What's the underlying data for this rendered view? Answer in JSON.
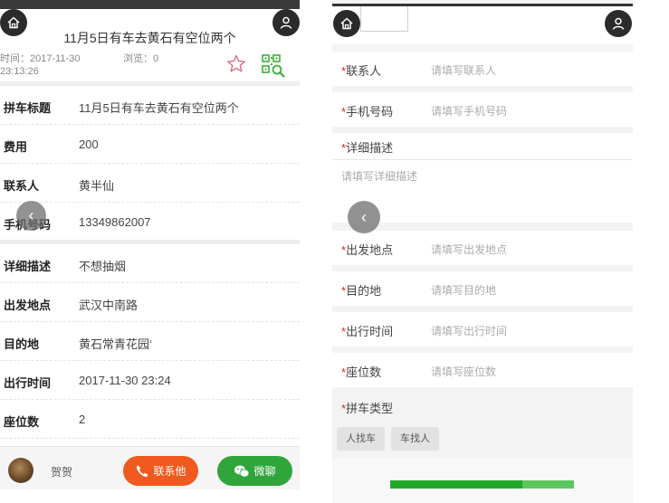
{
  "detail": {
    "title": "11月5日有车去黄石有空位两个",
    "time_label": "时间：2017-11-30 23:13:26",
    "views_label": "浏览：0",
    "rows": [
      {
        "label": "拼车标题",
        "value": "11月5日有车去黄石有空位两个"
      },
      {
        "label": "费用",
        "value": "200"
      },
      {
        "label": "联系人",
        "value": "黄半仙"
      },
      {
        "label": "手机号码",
        "value": "13349862007"
      },
      {
        "label": "详细描述",
        "value": "不想抽烟"
      },
      {
        "label": "出发地点",
        "value": "武汉中南路"
      },
      {
        "label": "目的地",
        "value": "黄石常青花园‘"
      },
      {
        "label": "出行时间",
        "value": "2017-11-30 23:24"
      },
      {
        "label": "座位数",
        "value": "2"
      }
    ],
    "footer": {
      "username": "贺贺",
      "call_label": "联系他",
      "wechat_label": "微聊"
    },
    "colors": {
      "call": "#f05a1e",
      "wechat": "#2fa53a",
      "favorite": "#e0607e",
      "qr": "#3fae3a"
    },
    "icons": [
      "home-icon",
      "user-icon",
      "star-icon",
      "qr-code-icon",
      "chevron-left-icon",
      "phone-icon",
      "wechat-icon"
    ]
  },
  "form": {
    "fields": [
      {
        "label": "联系人",
        "placeholder": "请填写联系人"
      },
      {
        "label": "手机号码",
        "placeholder": "请填写手机号码"
      },
      {
        "label": "详细描述",
        "placeholder": "请填写详细描述"
      },
      {
        "label": "出发地点",
        "placeholder": "请填写出发地点"
      },
      {
        "label": "目的地",
        "placeholder": "请填写目的地"
      },
      {
        "label": "出行时间",
        "placeholder": "请填写出行时间"
      },
      {
        "label": "座位数",
        "placeholder": "请填写座位数"
      },
      {
        "label": "拼车类型"
      }
    ],
    "required_mark": "*",
    "type_options": [
      "人找车",
      "车找人"
    ],
    "progress": 0.72,
    "colors": {
      "required": "#e02020",
      "progress_fill": "#20a82b",
      "progress_track": "#5cc75f"
    }
  }
}
